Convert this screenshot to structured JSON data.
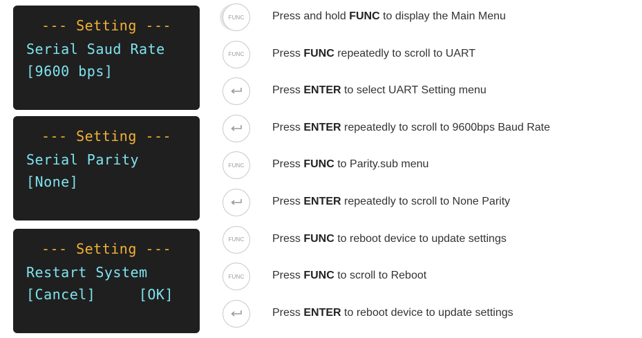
{
  "screens": [
    {
      "title": "--- Setting ---",
      "line2": "Serial Saud Rate",
      "line3": "[9600 bps]",
      "line3_right": ""
    },
    {
      "title": "--- Setting ---",
      "line2": "Serial Parity",
      "line3": "[None]",
      "line3_right": ""
    },
    {
      "title": "--- Setting ---",
      "line2": "Restart System",
      "line3": "[Cancel]",
      "line3_right": "[OK]"
    }
  ],
  "steps": [
    {
      "icon": "func-button-icon",
      "icon_label": "FUNC",
      "pre": "Press and hold ",
      "key": "FUNC",
      "post": " to display the Main Menu"
    },
    {
      "icon": "func-button-icon",
      "icon_label": "FUNC",
      "pre": "Press ",
      "key": "FUNC",
      "post": " repeatedly to scroll to UART"
    },
    {
      "icon": "enter-button-icon",
      "icon_label": "",
      "pre": "Press ",
      "key": "ENTER",
      "post": " to select UART Setting menu"
    },
    {
      "icon": "enter-button-icon",
      "icon_label": "",
      "pre": "Press ",
      "key": "ENTER",
      "post": " repeatedly to scroll to 9600bps Baud Rate"
    },
    {
      "icon": "func-button-icon",
      "icon_label": "FUNC",
      "pre": "Press ",
      "key": "FUNC",
      "post": " to Parity.sub menu"
    },
    {
      "icon": "enter-button-icon",
      "icon_label": "",
      "pre": "Press ",
      "key": "ENTER",
      "post": " repeatedly to scroll to None Parity"
    },
    {
      "icon": "func-button-icon",
      "icon_label": "FUNC",
      "pre": "Press ",
      "key": "FUNC",
      "post": " to reboot device to update settings"
    },
    {
      "icon": "func-button-icon",
      "icon_label": "FUNC",
      "pre": "Press ",
      "key": "FUNC",
      "post": " to scroll to Reboot"
    },
    {
      "icon": "enter-button-icon",
      "icon_label": "",
      "pre": "Press ",
      "key": "ENTER",
      "post": " to reboot device to update settings"
    }
  ],
  "colors": {
    "lcd_bg": "#1f1f1f",
    "lcd_title": "#f2b134",
    "lcd_text": "#7fe3ee",
    "icon_border": "#c8c8c8"
  }
}
